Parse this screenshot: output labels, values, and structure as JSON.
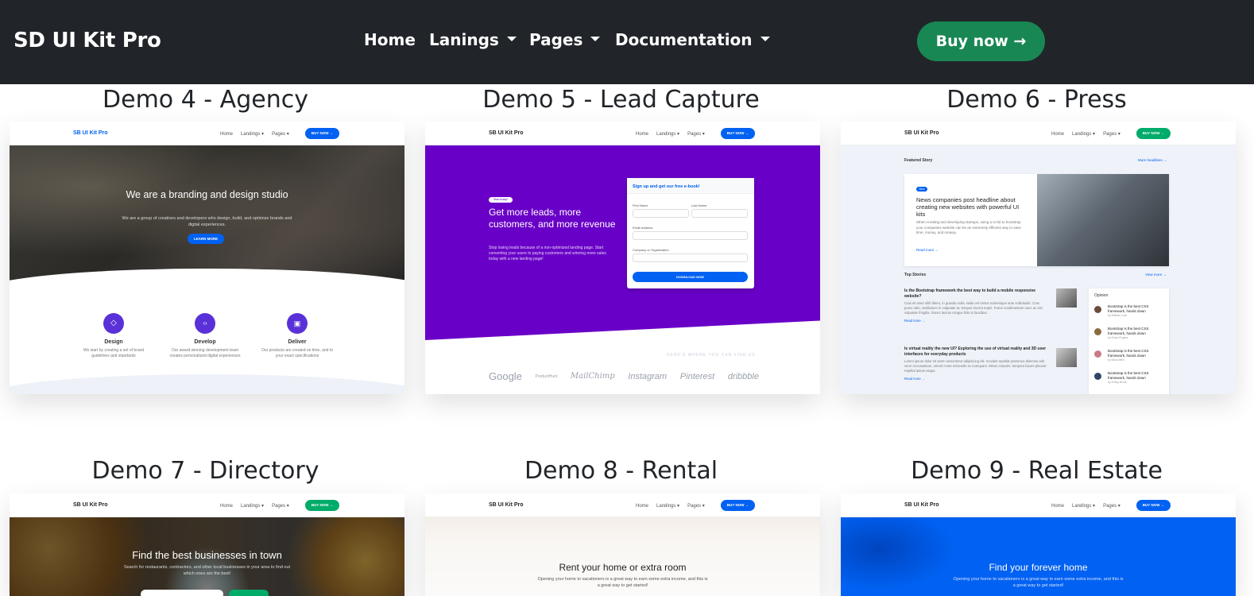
{
  "navbar": {
    "brand": "SD UI Kit Pro",
    "items": [
      {
        "label": "Home"
      },
      {
        "label": "Lanings"
      },
      {
        "label": "Pages"
      },
      {
        "label": "Documentation"
      }
    ],
    "buy_label": "Buy now →"
  },
  "demos": [
    {
      "title": "Demo 4 - Agency",
      "mini_brand": "SB UI Kit Pro",
      "links": [
        "Home",
        "Landings ▾",
        "Pages ▾"
      ],
      "btn": "BUY NOW →",
      "hero_title": "We are a branding and design studio",
      "hero_sub": "We are a group of creatives and developers who design, build, and optimize brands and digital experiences.",
      "hero_btn": "LEARN MORE",
      "features": [
        {
          "name": "Design",
          "desc": "We start by creating a set of brand guidelines and standards"
        },
        {
          "name": "Develop",
          "desc": "Our award winning development team creates personalized digital experiences"
        },
        {
          "name": "Deliver",
          "desc": "Our products are created on time, and to your exact specifications"
        }
      ]
    },
    {
      "title": "Demo 5 - Lead Capture",
      "mini_brand": "SB UI Kit Pro",
      "links": [
        "Home",
        "Landings ▾",
        "Pages ▾"
      ],
      "btn": "BUY NOW →",
      "badge": "Start today!",
      "hero_title": "Get more leads, more customers, and more revenue",
      "hero_sub": "Stop losing leads because of a non-optimized landing page. Start converting your users to paying customers and winning more sales today with a new landing page!",
      "form_title": "Sign up and get our free e-book!",
      "first_name": "First Name",
      "last_name": "Last Name",
      "email": "Email address",
      "company": "Company or Organization",
      "form_btn": "DOWNLOAD NOW",
      "find_us": "HERE'S WHERE YOU CAN FIND US",
      "logos": [
        "Google",
        "ProductHunt",
        "MailChimp",
        "Instagram",
        "Pinterest",
        "dribbble"
      ]
    },
    {
      "title": "Demo 6 - Press",
      "mini_brand": "SB UI Kit Pro",
      "links": [
        "Home",
        "Landings ▾",
        "Pages ▾"
      ],
      "btn": "BUY NOW →",
      "featured": "Featured Story",
      "more_headlines": "More headlines →",
      "tag": "New",
      "story_title": "News companies post headline about creating new websites with powerful UI kits",
      "story_text": "When creating and developing startups, using a UI kit to bootstrap your companies website can be an extremely efficient way to save time, money, and runway.",
      "read_more": "Read more →",
      "top_stories": "Top Stories",
      "view_more": "View more →",
      "stories": [
        {
          "title": "Is the Bootstrap framework the best way to build a mobile responsive website?",
          "text": "Cras sit amet nibh libero, in gravida nulla. Nulla vel metus scelerisque ante sollicitudin. Cras purus odio, vestibulum in vulputate at, tempus viverra turpis. Fusce condimentum nunc ac nisi vulputate fringilla. Donec lacinia congue felis in faucibus.",
          "read": "Read more →"
        },
        {
          "title": "Is virtual reality the new UI? Exploring the use of virtual reality and 3D user interfaces for everyday products",
          "text": "Lorem ipsum dolor sit amet consectetur adipisicing elit. Incidunt repellat possimus delectus odit vero! Accusantium, omnis! Amet reiciendis ex numquam. Minus corporis, tempora facere placeat repellat ipsum esque.",
          "read": "Read more →"
        }
      ],
      "opinion": "Opinion",
      "opinions": [
        {
          "title": "Bootstrap is the best CSS framework, hands down",
          "by": "by William Cole"
        },
        {
          "title": "Bootstrap is the best CSS framework, hands down",
          "by": "by Ewah Rogers"
        },
        {
          "title": "Bootstrap is the best CSS framework, hands down",
          "by": "by Alicia Wen"
        },
        {
          "title": "Bootstrap is the best CSS framework, hands down",
          "by": "by Kerby Brook"
        }
      ]
    },
    {
      "title": "Demo 7 - Directory",
      "mini_brand": "SB UI Kit Pro",
      "links": [
        "Home",
        "Landings ▾",
        "Pages ▾"
      ],
      "btn": "BUY NOW →",
      "hero_title": "Find the best businesses in town",
      "hero_sub": "Search for restaurants, contractors, and other local businesses in your area to find out which ones are the best!"
    },
    {
      "title": "Demo 8 - Rental",
      "mini_brand": "SB UI Kit Pro",
      "links": [
        "Home",
        "Landings ▾",
        "Pages ▾"
      ],
      "btn": "BUY NOW →",
      "hero_title": "Rent your home or extra room",
      "hero_sub": "Opening your home to vacationers is a great way to earn some extra income, and this is a great way to get started!"
    },
    {
      "title": "Demo 9 - Real Estate",
      "mini_brand": "SB UI Kit Pro",
      "links": [
        "Home",
        "Landings ▾",
        "Pages ▾"
      ],
      "btn": "BUY NOW →",
      "hero_title": "Find your forever home",
      "hero_sub": "Opening your home to vacationers is a great way to earn some extra income, and this is a great way to get started!"
    }
  ],
  "colors": {
    "navbar": "#212529",
    "buy": "#198754",
    "primary": "#0061f2",
    "purple": "#6900c7",
    "green": "#00ac69"
  }
}
